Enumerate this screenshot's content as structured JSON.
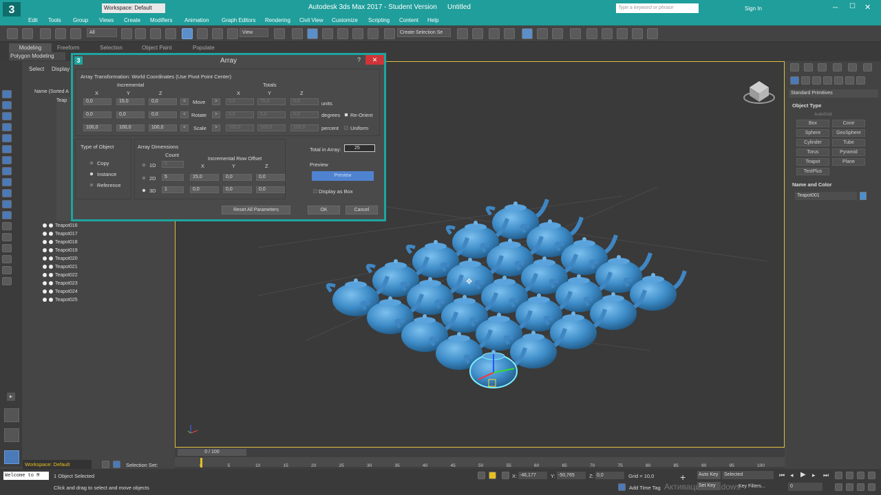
{
  "app": {
    "title": "Autodesk 3ds Max 2017 - Student Version",
    "file": "Untitled",
    "workspace_top": "Workspace: Default",
    "search_placeholder": "Type a keyword or phrase",
    "signin": "Sign In",
    "logo_text": "3"
  },
  "menu": [
    "Edit",
    "Tools",
    "Group",
    "Views",
    "Create",
    "Modifiers",
    "Animation",
    "Graph Editors",
    "Rendering",
    "Civil View",
    "Customize",
    "Scripting",
    "Content",
    "Help"
  ],
  "toolbar": {
    "filter": "All",
    "view": "View",
    "selection_set": "Create Selection Se"
  },
  "ribbon": {
    "tabs": [
      "Modeling",
      "Freeform",
      "Selection",
      "Object Paint",
      "Populate"
    ],
    "sub": "Polygon Modeling"
  },
  "scene": {
    "tabs": [
      "Select",
      "Display"
    ],
    "column": "Name (Sorted A",
    "visible_items": [
      "Teapot016",
      "Teapot017",
      "Teapot018",
      "Teapot019",
      "Teapot020",
      "Teapot021",
      "Teapot022",
      "Teapot023",
      "Teapot024",
      "Teapot025"
    ],
    "hidden_prefix": "Teap"
  },
  "dialog": {
    "title": "Array",
    "help": "?",
    "close": "✕",
    "transform_title": "Array Transformation: World Coordinates (Use Pivot Point Center)",
    "incremental": "Incremental",
    "totals": "Totals",
    "axes": [
      "X",
      "Y",
      "Z"
    ],
    "rows": [
      {
        "label": "Move",
        "inc": [
          "0,0",
          "15,0",
          "0,0"
        ],
        "tot": [
          "0,0",
          "75,0",
          "0,0"
        ],
        "unit": "units"
      },
      {
        "label": "Rotate",
        "inc": [
          "0,0",
          "0,0",
          "0,0"
        ],
        "tot": [
          "0,0",
          "0,0",
          "0,0"
        ],
        "unit": "degrees"
      },
      {
        "label": "Scale",
        "inc": [
          "100,0",
          "100,0",
          "100,0"
        ],
        "tot": [
          "100,0",
          "100,0",
          "100,0"
        ],
        "unit": "percent"
      }
    ],
    "reorient": "Re-Orient",
    "uniform": "Uniform",
    "type_title": "Type of Object",
    "types": [
      "Copy",
      "Instance",
      "Reference"
    ],
    "dims_title": "Array Dimensions",
    "count_label": "Count",
    "row_offset": "Incremental Row Offset",
    "dims": [
      {
        "label": "1D",
        "count": "5",
        "vals": []
      },
      {
        "label": "2D",
        "count": "5",
        "vals": [
          "15,0",
          "0,0",
          "0,0"
        ]
      },
      {
        "label": "3D",
        "count": "1",
        "vals": [
          "0,0",
          "0,0",
          "0,0"
        ]
      }
    ],
    "total_label": "Total in Array:",
    "total_value": "25",
    "preview_title": "Preview",
    "preview_btn": "Preview",
    "display_box": "Display as Box",
    "reset": "Reset All Parameters",
    "ok": "OK",
    "cancel": "Cancel"
  },
  "right": {
    "dropdown": "Standard Primitives",
    "object_type": "Object Type",
    "autogrid": "AutoGrid",
    "buttons": [
      "Box",
      "Cone",
      "Sphere",
      "GeoSphere",
      "Cylinder",
      "Tube",
      "Torus",
      "Pyramid",
      "Teapot",
      "Plane",
      "TextPlus"
    ],
    "name_color": "Name and Color",
    "name_value": "Teapot001",
    "color": "#4a90d0"
  },
  "timeline": {
    "frame": "0 / 100",
    "ticks": [
      "0",
      "5",
      "10",
      "15",
      "20",
      "25",
      "30",
      "35",
      "40",
      "45",
      "50",
      "55",
      "60",
      "65",
      "70",
      "75",
      "80",
      "85",
      "90",
      "95",
      "100"
    ]
  },
  "status": {
    "workspace": "Workspace: Default",
    "selection_set": "Selection Set:",
    "welcome": "Welcome to M",
    "selected": "1 Object Selected",
    "hint": "Click and drag to select and move objects",
    "x_label": "X:",
    "x": "-46,177",
    "y_label": "Y:",
    "y": "-50,765",
    "z_label": "Z:",
    "z": "0,0",
    "grid": "Grid = 10,0",
    "add_time_tag": "Add Time Tag",
    "auto_key": "Auto Key",
    "set_key": "Set Key",
    "key_mode": "Selected",
    "key_filters": "Key Filters...",
    "frame_field": "0",
    "watermark": "Активация Windows"
  }
}
